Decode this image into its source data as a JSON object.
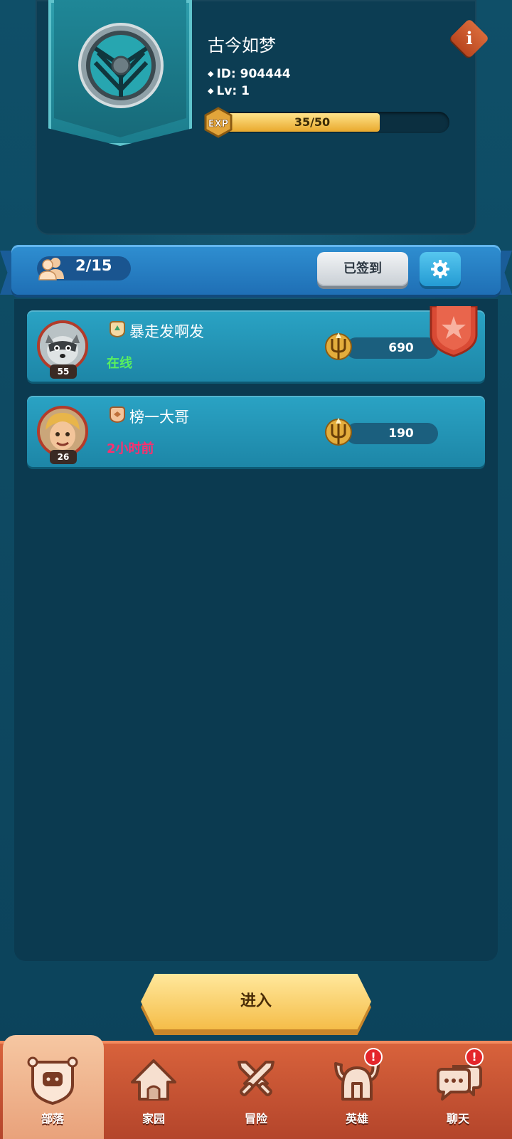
{
  "profile": {
    "name": "古今如梦",
    "id_label": "ID:",
    "id_value": "904444",
    "lv_label": "Lv:",
    "lv_value": "1",
    "exp_badge": "EXP",
    "exp_text": "35/50",
    "exp_current": 35,
    "exp_max": 50,
    "info_glyph": "i"
  },
  "tribe_bar": {
    "member_count": "2/15",
    "checkin_label": "已签到"
  },
  "members": [
    {
      "name": "暴走发啊发",
      "level": "55",
      "status": "在线",
      "score": "690",
      "avatar": "raccoon-avatar",
      "rank_icon": "leader-rank-icon",
      "is_leader": true
    },
    {
      "name": "榜一大哥",
      "level": "26",
      "status": "2小时前",
      "score": "190",
      "avatar": "boy-avatar",
      "rank_icon": "member-rank-icon",
      "is_leader": false
    }
  ],
  "enter_label": "进入",
  "nav": [
    {
      "label": "部落",
      "icon": "tribe-icon",
      "active": true,
      "alert": false
    },
    {
      "label": "家园",
      "icon": "home-icon",
      "active": false,
      "alert": false
    },
    {
      "label": "冒险",
      "icon": "swords-icon",
      "active": false,
      "alert": false
    },
    {
      "label": "英雄",
      "icon": "viking-helmet-icon",
      "active": false,
      "alert": true
    },
    {
      "label": "聊天",
      "icon": "chat-icon",
      "active": false,
      "alert": true
    }
  ],
  "alert_glyph": "!",
  "colors": {
    "background": "#0e4a62",
    "online": "#59f05f",
    "offline": "#ff2f6e",
    "accent_gold": "#f5bd49",
    "nav_red": "#c24f31"
  }
}
